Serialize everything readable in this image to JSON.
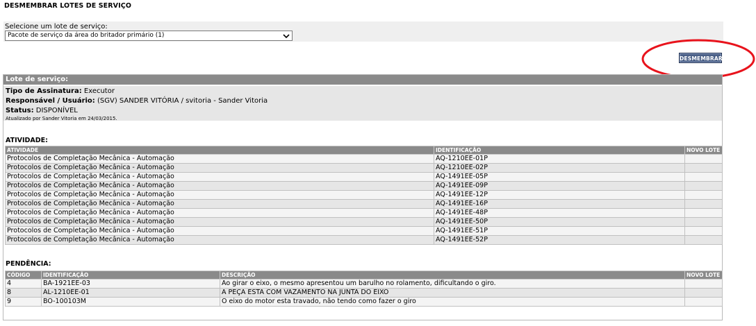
{
  "page": {
    "title": "DESMEMBRAR LOTES DE SERVIÇO"
  },
  "selector": {
    "label": "Selecione um lote de serviço:",
    "value": "Pacote de serviço da área do britador primário (1)"
  },
  "actions": {
    "split_label": "DESMEMBRAR"
  },
  "lot": {
    "header": "Lote de serviço:",
    "signature_type_label": "Tipo de Assinatura:",
    "signature_type_value": "Executor",
    "responsible_label": "Responsável / Usuário:",
    "responsible_value": "(SGV) SANDER VITÓRIA / svitoria - Sander Vitoria",
    "status_label": "Status:",
    "status_value": "DISPONÍVEL",
    "updated": "Atualizado por Sander Vitoria em 24/03/2015."
  },
  "activities": {
    "title": "ATIVIDADE:",
    "columns": [
      "ATIVIDADE",
      "IDENTIFICAÇÃO",
      "NOVO LOTE"
    ],
    "rows": [
      {
        "activity": "Protocolos de Completação Mecânica - Automação",
        "id": "AQ-1210EE-01P",
        "new_lot": ""
      },
      {
        "activity": "Protocolos de Completação Mecânica - Automação",
        "id": "AQ-1210EE-02P",
        "new_lot": ""
      },
      {
        "activity": "Protocolos de Completação Mecânica - Automação",
        "id": "AQ-1491EE-05P",
        "new_lot": ""
      },
      {
        "activity": "Protocolos de Completação Mecânica - Automação",
        "id": "AQ-1491EE-09P",
        "new_lot": ""
      },
      {
        "activity": "Protocolos de Completação Mecânica - Automação",
        "id": "AQ-1491EE-12P",
        "new_lot": ""
      },
      {
        "activity": "Protocolos de Completação Mecânica - Automação",
        "id": "AQ-1491EE-16P",
        "new_lot": ""
      },
      {
        "activity": "Protocolos de Completação Mecânica - Automação",
        "id": "AQ-1491EE-48P",
        "new_lot": ""
      },
      {
        "activity": "Protocolos de Completação Mecânica - Automação",
        "id": "AQ-1491EE-50P",
        "new_lot": ""
      },
      {
        "activity": "Protocolos de Completação Mecânica - Automação",
        "id": "AQ-1491EE-51P",
        "new_lot": ""
      },
      {
        "activity": "Protocolos de Completação Mecânica - Automação",
        "id": "AQ-1491EE-52P",
        "new_lot": ""
      }
    ]
  },
  "pendencies": {
    "title": "PENDÊNCIA:",
    "columns": [
      "CÓDIGO",
      "IDENTIFICAÇÃO",
      "DESCRIÇÃO",
      "NOVO LOTE"
    ],
    "rows": [
      {
        "code": "4",
        "id": "BA-1921EE-03",
        "description": "Ao girar o eixo, o mesmo apresentou um barulho no rolamento, dificultando o giro.",
        "new_lot": ""
      },
      {
        "code": "8",
        "id": "AL-1210EE-01",
        "description": "A PEÇA ESTA COM VAZAMENTO NA JUNTA DO EIXO",
        "new_lot": ""
      },
      {
        "code": "9",
        "id": "BO-100103M",
        "description": "O eixo do motor esta travado, não tendo como fazer o giro",
        "new_lot": ""
      }
    ]
  },
  "colors": {
    "header_gray": "#8a8a8a",
    "button_blue": "#4a5f86",
    "annotation_red": "#e8131c"
  }
}
